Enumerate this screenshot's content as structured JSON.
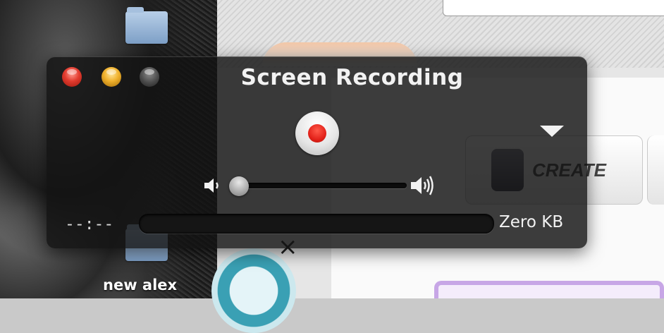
{
  "desktop": {
    "folder_labels": [
      "new alex"
    ]
  },
  "browser": {
    "create_card_label": "CREATE"
  },
  "window": {
    "title": "Screen Recording",
    "buttons": {
      "close": "close-button",
      "minimize": "minimize-button",
      "zoom": "zoom-button"
    }
  },
  "controls": {
    "record_icon": "record-icon",
    "options_icon": "triangle-down-icon",
    "volume_low_icon": "speaker-low-icon",
    "volume_high_icon": "speaker-high-icon",
    "volume_level": 0.0,
    "elapsed_time": "--:--",
    "file_size": "Zero KB",
    "progress": 0.0
  },
  "colors": {
    "record_red": "#e3221a",
    "close_red": "#e23b2e",
    "minimize_yellow": "#f0b12c",
    "hud_background": "#121212"
  }
}
